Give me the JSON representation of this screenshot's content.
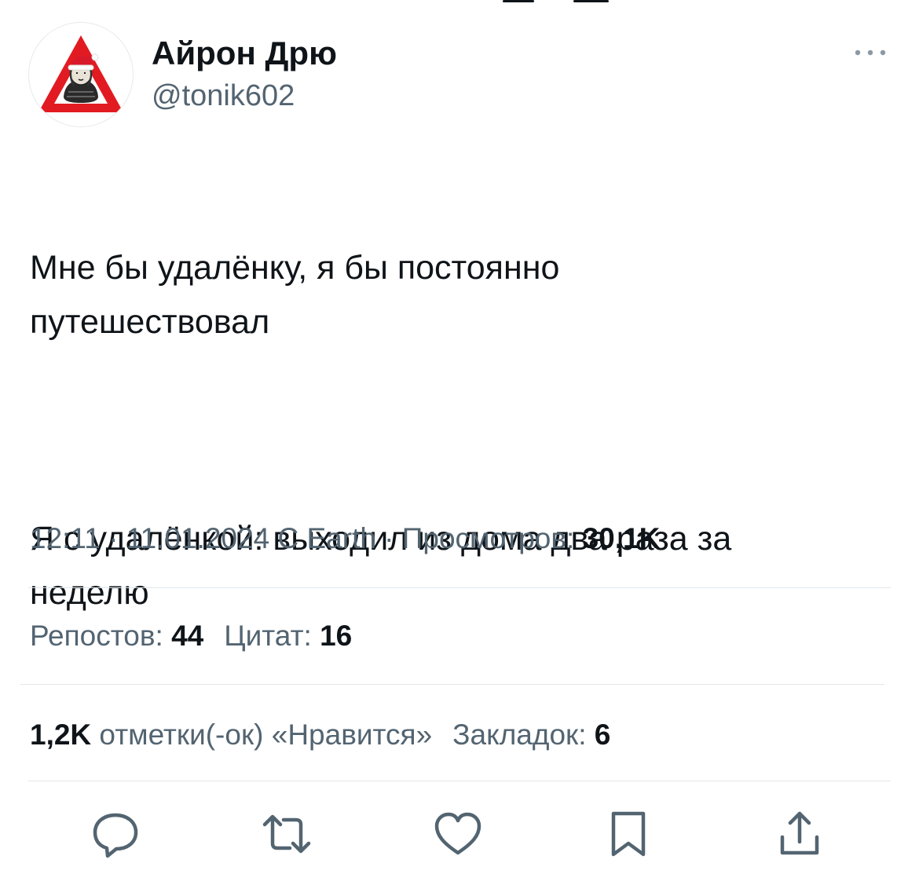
{
  "author": {
    "name": "Айрон Дрю",
    "handle": "@tonik602",
    "avatar_icon": "avatar-warning-sign-santa"
  },
  "tweet": {
    "paragraph_1": "Мне бы удалёнку, я бы постоянно\nпутешествовал",
    "paragraph_2": "Я с удалёнкой: выходил из дома два раза за\nнеделю"
  },
  "meta": {
    "time": "12:11",
    "separator_1": " · ",
    "date": "11.01.2024",
    "location": "С Earth",
    "separator_2": " · ",
    "views_label": "Просмотров: ",
    "views_count": "30,1K"
  },
  "stats": {
    "reposts_label": "Репостов: ",
    "reposts_count": "44",
    "quotes_label": "Цитат: ",
    "quotes_count": "16",
    "likes_count": "1,2K",
    "likes_label": " отметки(-ок) «Нравится»",
    "bookmarks_label": "Закладок: ",
    "bookmarks_count": "6"
  },
  "actions": [
    "reply-icon",
    "retweet-icon",
    "like-icon",
    "bookmark-icon",
    "share-icon"
  ],
  "colors": {
    "text_primary": "#0f1419",
    "text_secondary": "#536471",
    "divider": "#e2e6e9",
    "avatar_sign_red": "#e21b22"
  }
}
